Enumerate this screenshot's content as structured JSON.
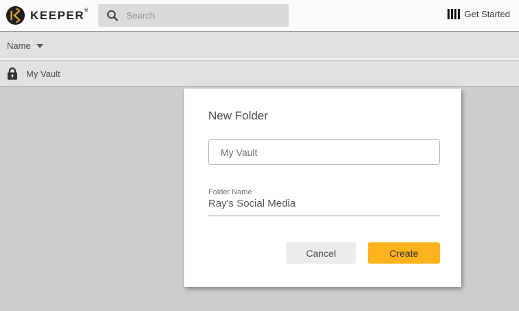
{
  "topbar": {
    "brand": "KEEPER",
    "brand_reg_mark": "®",
    "search_placeholder": "Search",
    "get_started_label": "Get Started"
  },
  "table": {
    "name_header": "Name",
    "rows": [
      {
        "icon": "lock-icon",
        "label": "My Vault"
      }
    ]
  },
  "modal": {
    "title": "New Folder",
    "parent_folder_value": "My Vault",
    "folder_name_label": "Folder Name",
    "folder_name_value": "Ray's Social Media",
    "cancel_label": "Cancel",
    "create_label": "Create"
  },
  "colors": {
    "accent": "#fdb41c",
    "topbar_bg": "#fbfbfb",
    "row_bg": "#e1e1e1",
    "page_bg": "#cdcdcd",
    "logo_dark": "#1f1f1f",
    "logo_gold": "#d1a238"
  }
}
